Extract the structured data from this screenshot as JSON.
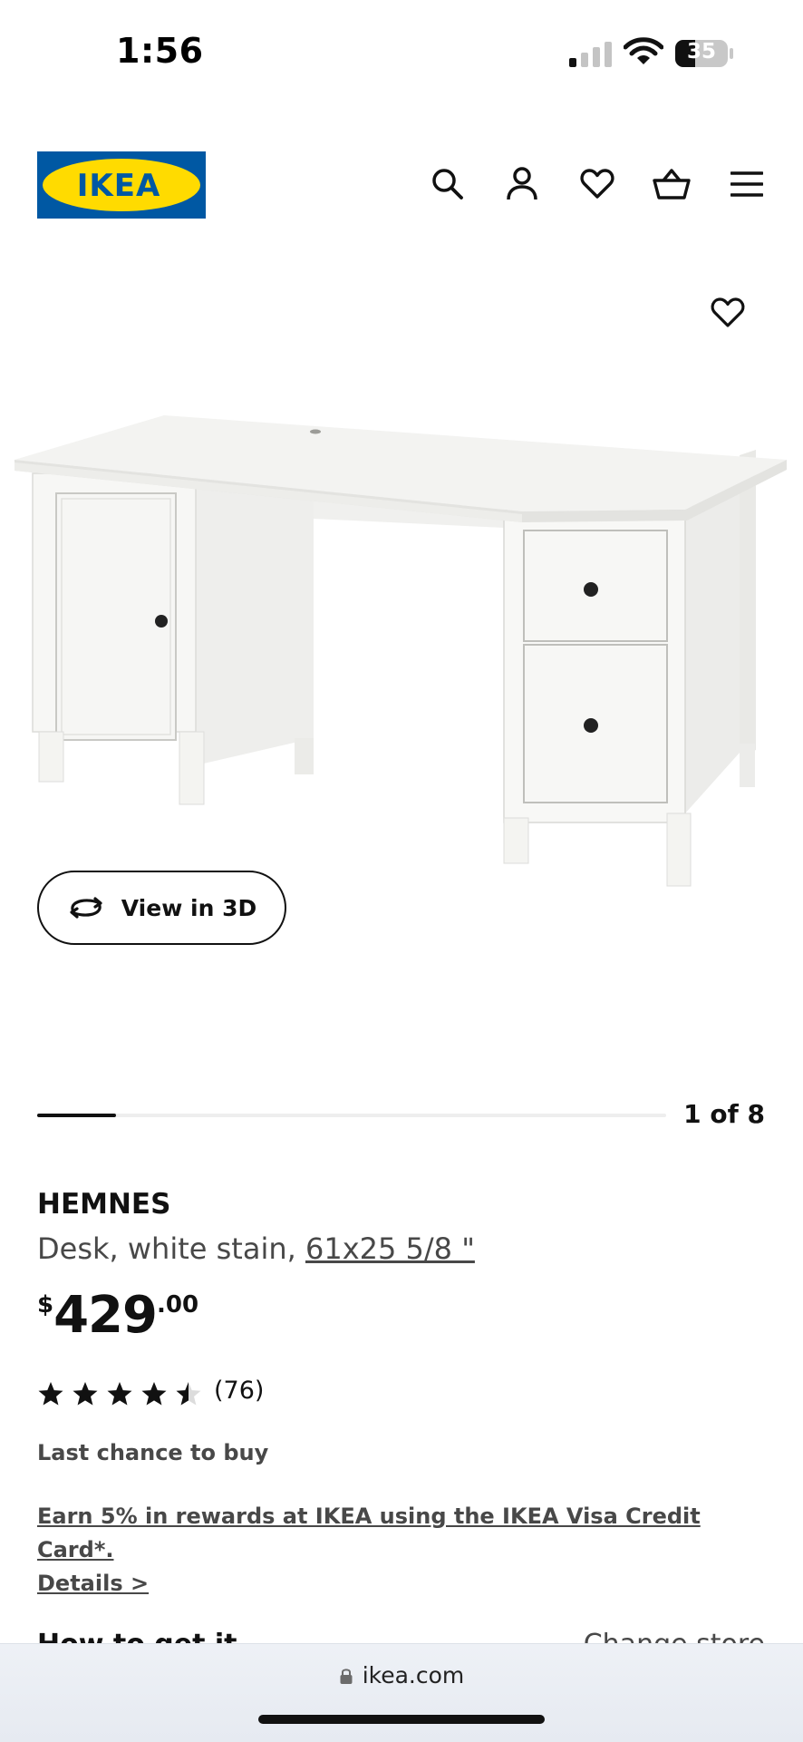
{
  "status_bar": {
    "time": "1:56",
    "battery": "35"
  },
  "header": {
    "logo_text": "IKEA",
    "brand_colors": {
      "blue": "#0058A3",
      "yellow": "#FFDB00"
    },
    "icons": [
      "search-icon",
      "account-icon",
      "heart-icon",
      "basket-icon",
      "menu-icon"
    ]
  },
  "gallery": {
    "view_3d_label": "View in 3D",
    "pager_text": "1 of 8",
    "current_image": 1,
    "total_images": 8
  },
  "product": {
    "name": "HEMNES",
    "description_prefix": "Desk, white stain, ",
    "description_size": "61x25 5/8 \"",
    "price": {
      "currency": "$",
      "integer": "429",
      "decimal": ".00"
    },
    "rating": {
      "stars": 4.5,
      "max": 5,
      "count": "(76)"
    },
    "availability": "Last chance to buy",
    "promo_line1": "Earn 5% in rewards at IKEA using the IKEA Visa Credit Card*.",
    "promo_line2": "Details >"
  },
  "section": {
    "title": "How to get it",
    "action": "Change store"
  },
  "browser": {
    "url": "ikea.com"
  }
}
